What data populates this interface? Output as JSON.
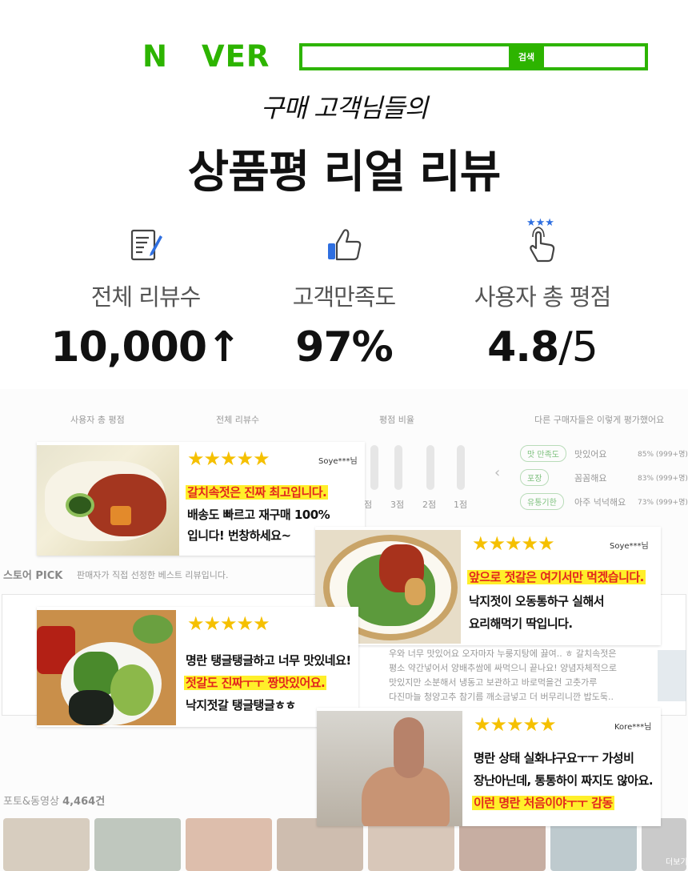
{
  "header": {
    "logo_left": "N",
    "logo_right": "VER",
    "search_button": "검색",
    "subtitle": "구매 고객님들의",
    "title": "상품평 리얼 리뷰"
  },
  "stats": [
    {
      "label": "전체 리뷰수",
      "value": "10,000↑",
      "icon": "review-document-icon"
    },
    {
      "label": "고객만족도",
      "value": "97%",
      "icon": "thumbs-up-icon"
    },
    {
      "label": "사용자 총 평점",
      "value_main": "4.8",
      "value_rest": "/5",
      "icon": "star-hand-icon"
    }
  ],
  "background": {
    "headers": [
      "사용자 총 평점",
      "전체 리뷰수",
      "평점 비율",
      "다른 구매자들은 이렇게 평가했어요"
    ],
    "ratings": [
      "3점",
      "2점",
      "1점"
    ],
    "feedback": [
      {
        "tag": "맛 만족도",
        "text": "맛있어요",
        "pct": "85% (999+명)"
      },
      {
        "tag": "포장",
        "text": "꼼꼼해요",
        "pct": "83% (999+명)"
      },
      {
        "tag": "유통기한",
        "text": "아주 넉넉해요",
        "pct": "73% (999+명)"
      }
    ],
    "store_pick": "스토어 PICK",
    "store_pick_desc": "판매자가 직접 선정한 베스트 리뷰입니다.",
    "review_text": [
      "우와 너무 맛있어요 오자마자 누룽지탕에 끓여.. ㅎ 갈치속젓은",
      "평소 약간넣어서 양배추쌈에 싸먹으니 끝나요! 양념자체적으로",
      "맛있지만 소분해서 냉동고 보관하고 바로먹을건 고춧가루",
      "다진마늘 청양고추 참기름 깨소금넣고 더 버무리니깐 밥도둑.."
    ],
    "photo_count_label": "포토&동영상",
    "photo_count": "4,464건",
    "more": "더보기"
  },
  "reviews": [
    {
      "stars": "★★★★★",
      "user": "Soye***님",
      "lines": [
        {
          "t": "갈치속젓은 진짜 최고입니다.",
          "hl": true
        },
        {
          "t": "배송도 빠르고 재구매 100%",
          "hl": false
        },
        {
          "t": "입니다! 번창하세요~",
          "hl": false
        }
      ]
    },
    {
      "stars": "★★★★★",
      "user": "Soye***님",
      "lines": [
        {
          "t": "앞으로 젓갈은 여기서만 먹겠습니다.",
          "hl": true
        },
        {
          "t": "낙지젓이 오동통하구 실해서",
          "hl": false
        },
        {
          "t": "요리해먹기 딱입니다.",
          "hl": false
        }
      ]
    },
    {
      "stars": "★★★★★",
      "user": "",
      "lines": [
        {
          "t": "명란 탱글탱글하고 너무 맛있네요!",
          "hl": false
        },
        {
          "t": "젓갈도 진짜ㅜㅜ 짱맛있어요.",
          "hl": true
        },
        {
          "t": "낙지젓갈 탱글탱글ㅎㅎ",
          "hl": false
        }
      ]
    },
    {
      "stars": "★★★★★",
      "user": "Kore***님",
      "lines": [
        {
          "t": "명란 상태 실화냐구요ㅜㅜ 가성비",
          "hl": false
        },
        {
          "t": "장난아닌데, 통통하이 짜지도 않아요.",
          "hl": false
        },
        {
          "t": "이런 명란 처음이야ㅜㅜ 감동",
          "hl": true
        }
      ]
    }
  ],
  "colors": {
    "brand_green": "#2db400",
    "star": "#f5c000",
    "highlight": "#ffef2a",
    "highlight_text": "#e2261d",
    "icon_blue": "#2f6fe0"
  }
}
